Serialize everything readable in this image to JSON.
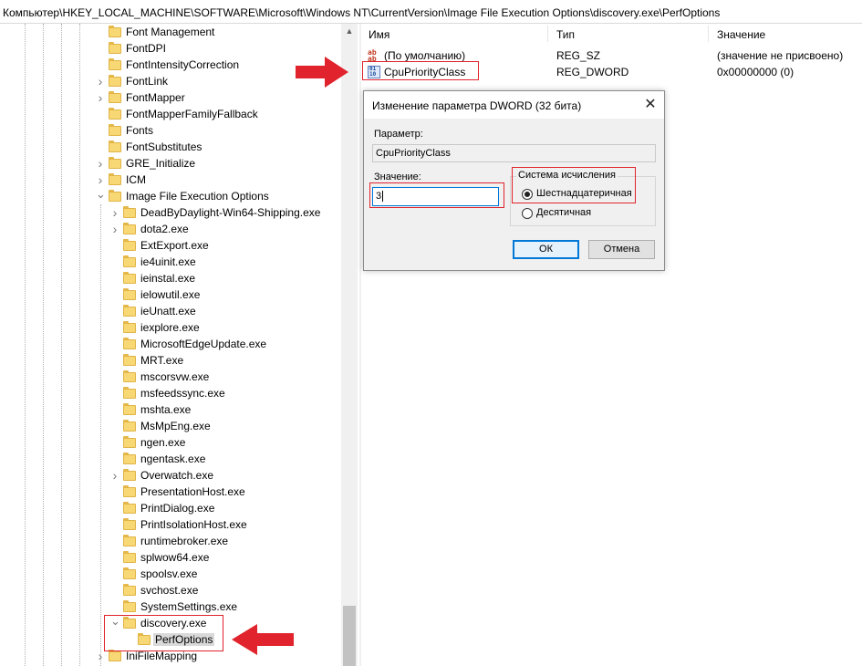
{
  "address_bar": {
    "path": "Компьютер\\HKEY_LOCAL_MACHINE\\SOFTWARE\\Microsoft\\Windows NT\\CurrentVersion\\Image File Execution Options\\discovery.exe\\PerfOptions"
  },
  "tree": {
    "items": [
      {
        "label": "Font Management",
        "expander": "none"
      },
      {
        "label": "FontDPI",
        "expander": "none"
      },
      {
        "label": "FontIntensityCorrection",
        "expander": "none"
      },
      {
        "label": "FontLink",
        "expander": "collapsed"
      },
      {
        "label": "FontMapper",
        "expander": "collapsed"
      },
      {
        "label": "FontMapperFamilyFallback",
        "expander": "none"
      },
      {
        "label": "Fonts",
        "expander": "none"
      },
      {
        "label": "FontSubstitutes",
        "expander": "none"
      },
      {
        "label": "GRE_Initialize",
        "expander": "collapsed"
      },
      {
        "label": "ICM",
        "expander": "collapsed"
      },
      {
        "label": "Image File Execution Options",
        "expander": "expanded"
      },
      {
        "label": "DeadByDaylight-Win64-Shipping.exe",
        "expander": "collapsed"
      },
      {
        "label": "dota2.exe",
        "expander": "collapsed"
      },
      {
        "label": "ExtExport.exe",
        "expander": "none"
      },
      {
        "label": "ie4uinit.exe",
        "expander": "none"
      },
      {
        "label": "ieinstal.exe",
        "expander": "none"
      },
      {
        "label": "ielowutil.exe",
        "expander": "none"
      },
      {
        "label": "ieUnatt.exe",
        "expander": "none"
      },
      {
        "label": "iexplore.exe",
        "expander": "none"
      },
      {
        "label": "MicrosoftEdgeUpdate.exe",
        "expander": "none"
      },
      {
        "label": "MRT.exe",
        "expander": "none"
      },
      {
        "label": "mscorsvw.exe",
        "expander": "none"
      },
      {
        "label": "msfeedssync.exe",
        "expander": "none"
      },
      {
        "label": "mshta.exe",
        "expander": "none"
      },
      {
        "label": "MsMpEng.exe",
        "expander": "none"
      },
      {
        "label": "ngen.exe",
        "expander": "none"
      },
      {
        "label": "ngentask.exe",
        "expander": "none"
      },
      {
        "label": "Overwatch.exe",
        "expander": "collapsed"
      },
      {
        "label": "PresentationHost.exe",
        "expander": "none"
      },
      {
        "label": "PrintDialog.exe",
        "expander": "none"
      },
      {
        "label": "PrintIsolationHost.exe",
        "expander": "none"
      },
      {
        "label": "runtimebroker.exe",
        "expander": "none"
      },
      {
        "label": "splwow64.exe",
        "expander": "none"
      },
      {
        "label": "spoolsv.exe",
        "expander": "none"
      },
      {
        "label": "svchost.exe",
        "expander": "none"
      },
      {
        "label": "SystemSettings.exe",
        "expander": "none"
      },
      {
        "label": "discovery.exe",
        "expander": "expanded"
      },
      {
        "label": "PerfOptions",
        "expander": "none",
        "selected": true
      },
      {
        "label": "IniFileMapping",
        "expander": "collapsed"
      }
    ]
  },
  "values_list": {
    "headers": {
      "name": "Имя",
      "type": "Тип",
      "data": "Значение"
    },
    "rows": [
      {
        "icon": "string-value-icon",
        "name": "(По умолчанию)",
        "type": "REG_SZ",
        "data": "(значение не присвоено)"
      },
      {
        "icon": "dword-value-icon",
        "name": "CpuPriorityClass",
        "type": "REG_DWORD",
        "data": "0x00000000 (0)"
      }
    ]
  },
  "dialog": {
    "title": "Изменение параметра DWORD (32 бита)",
    "param_label": "Параметр:",
    "param_value": "CpuPriorityClass",
    "value_label": "Значение:",
    "value_input": "3",
    "base_group_label": "Система исчисления",
    "radio_hex": "Шестнадцатеричная",
    "radio_dec": "Десятичная",
    "selected_base": "hex",
    "ok_label": "ОК",
    "cancel_label": "Отмена"
  },
  "annotations": {
    "highlight_color": "#e0232c"
  }
}
